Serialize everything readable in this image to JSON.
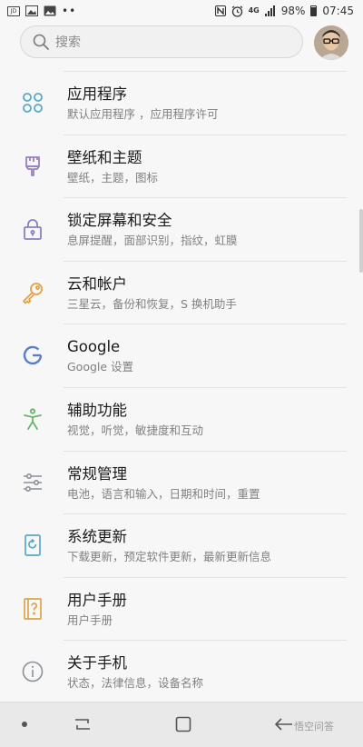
{
  "status_bar": {
    "left_badge": "JD",
    "dots": "••",
    "network": "4G",
    "battery": "98%",
    "time": "07:45"
  },
  "search": {
    "placeholder": "搜索"
  },
  "settings": [
    {
      "title": "应用程序",
      "subtitle": "默认应用程序 ，应用程序许可",
      "icon": "apps-icon",
      "color": "#5aa7c9"
    },
    {
      "title": "壁纸和主题",
      "subtitle": "壁纸，主题，图标",
      "icon": "brush-icon",
      "color": "#9a7fc4"
    },
    {
      "title": "锁定屏幕和安全",
      "subtitle": "息屏提醒，面部识别，指纹，虹膜",
      "icon": "lock-icon",
      "color": "#8a7fc0"
    },
    {
      "title": "云和帐户",
      "subtitle": "三星云，备份和恢复，S 换机助手",
      "icon": "key-icon",
      "color": "#e0a24a"
    },
    {
      "title": "Google",
      "subtitle": "Google 设置",
      "icon": "google-icon",
      "color": "#5b7fc7"
    },
    {
      "title": "辅助功能",
      "subtitle": "视觉，听觉，敏捷度和互动",
      "icon": "accessibility-icon",
      "color": "#6bb36b"
    },
    {
      "title": "常规管理",
      "subtitle": "电池，语言和输入，日期和时间，重置",
      "icon": "sliders-icon",
      "color": "#8a8f99"
    },
    {
      "title": "系统更新",
      "subtitle": "下载更新，预定软件更新，最新更新信息",
      "icon": "system-update-icon",
      "color": "#5aa7c9"
    },
    {
      "title": "用户手册",
      "subtitle": "用户手册",
      "icon": "user-manual-icon",
      "color": "#e0a24a"
    },
    {
      "title": "关于手机",
      "subtitle": "状态，法律信息，设备名称",
      "icon": "info-icon",
      "color": "#8a8f99"
    }
  ],
  "watermark": "悟空问答"
}
